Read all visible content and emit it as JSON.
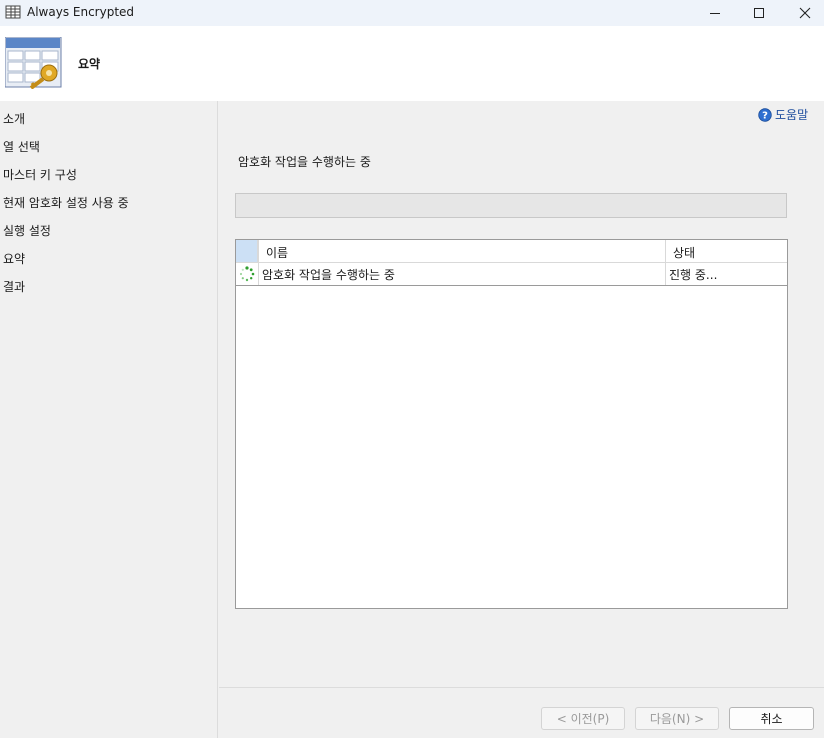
{
  "window": {
    "title": "Always Encrypted",
    "icon": "table-icon",
    "controls": [
      "minimize-icon",
      "maximize-icon",
      "close-icon"
    ]
  },
  "header": {
    "title": "요약",
    "icon": "table-key-icon"
  },
  "nav": {
    "items": [
      {
        "label": "소개"
      },
      {
        "label": "열 선택"
      },
      {
        "label": "마스터 키 구성"
      },
      {
        "label": "현재 암호화 설정 사용 중"
      },
      {
        "label": "실행 설정"
      },
      {
        "label": "요약"
      },
      {
        "label": "결과"
      }
    ]
  },
  "help": {
    "label": "도움말",
    "icon": "help-icon"
  },
  "main": {
    "status_text": "암호화 작업을 수행하는 중",
    "progress": 0
  },
  "grid": {
    "columns": {
      "name": "이름",
      "status": "상태"
    },
    "rows": [
      {
        "icon": "spinner-icon",
        "name": "암호화 작업을 수행하는 중",
        "status": "진행 중..."
      }
    ]
  },
  "footer": {
    "prev_label": "< 이전(P)",
    "next_label": "다음(N) >",
    "cancel_label": "취소"
  },
  "colors": {
    "accent": "#1f4e9e",
    "selection": "#cce0f5",
    "spinner": "#2e9e2e"
  }
}
